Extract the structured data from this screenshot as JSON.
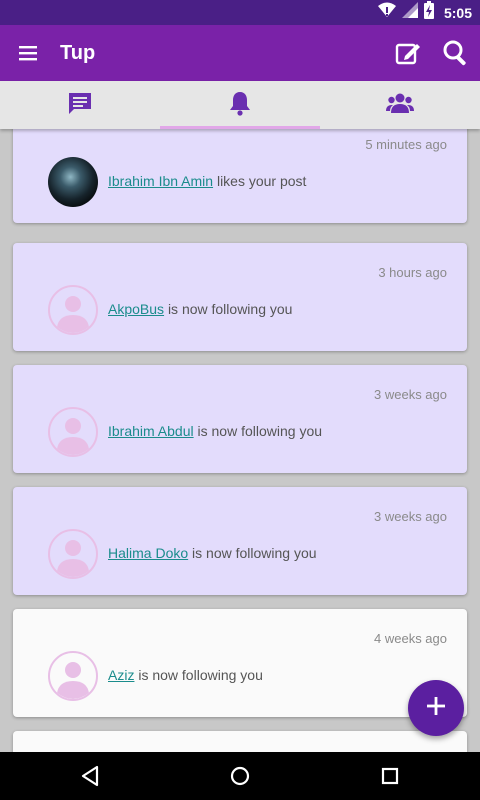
{
  "status_bar": {
    "time": "5:05"
  },
  "app_bar": {
    "title": "Tup"
  },
  "tabs": [
    {
      "name": "messages",
      "icon": "message-icon"
    },
    {
      "name": "notifications",
      "icon": "bell-icon",
      "active": true
    },
    {
      "name": "people",
      "icon": "group-icon"
    }
  ],
  "notifications": [
    {
      "time": "5 minutes ago",
      "user": "Ibrahim Ibn Amin",
      "action": "likes your post",
      "avatar": "photo",
      "unread": true
    },
    {
      "time": "3 hours ago",
      "user": "AkpoBus",
      "action": "is now following you",
      "avatar": "placeholder",
      "unread": true
    },
    {
      "time": "3 weeks ago",
      "user": "Ibrahim Abdul",
      "action": "is now following you",
      "avatar": "placeholder",
      "unread": true
    },
    {
      "time": "3 weeks ago",
      "user": "Halima Doko",
      "action": "is now following you",
      "avatar": "placeholder",
      "unread": true
    },
    {
      "time": "4 weeks ago",
      "user": "Aziz",
      "action": "is now following you",
      "avatar": "placeholder",
      "unread": false
    }
  ],
  "colors": {
    "status_bar": "#4a1f86",
    "app_bar": "#7a22a8",
    "unread_card": "#e3dcfc",
    "link": "#1a8c8c",
    "fab": "#5b1fa0"
  }
}
